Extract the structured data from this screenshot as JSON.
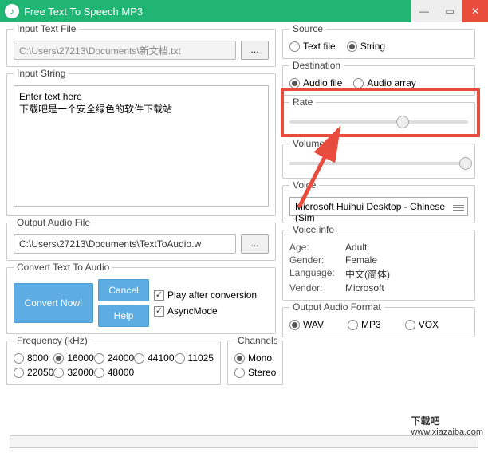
{
  "window": {
    "title": "Free Text To Speech MP3"
  },
  "left": {
    "input_file": {
      "legend": "Input Text File",
      "path": "C:\\Users\\27213\\Documents\\新文档.txt",
      "browse": "..."
    },
    "input_string": {
      "legend": "Input String",
      "placeholder": "Enter text here",
      "text": "下载吧是一个安全绿色的软件下载站"
    },
    "output_file": {
      "legend": "Output Audio File",
      "path": "C:\\Users\\27213\\Documents\\TextToAudio.w",
      "browse": "..."
    },
    "convert": {
      "legend": "Convert Text To Audio",
      "convert_now": "Convert Now!",
      "cancel": "Cancel",
      "help": "Help",
      "play_after": "Play after conversion",
      "async_mode": "AsyncMode"
    },
    "frequency": {
      "legend": "Frequency (kHz)",
      "options": [
        "8000",
        "16000",
        "24000",
        "44100",
        "11025",
        "22050",
        "32000",
        "48000"
      ],
      "selected": "16000"
    },
    "channels": {
      "legend": "Channels",
      "options": [
        "Mono",
        "Stereo"
      ],
      "selected": "Mono"
    }
  },
  "right": {
    "source": {
      "legend": "Source",
      "options": [
        "Text file",
        "String"
      ],
      "selected": "String"
    },
    "destination": {
      "legend": "Destination",
      "options": [
        "Audio file",
        "Audio array"
      ],
      "selected": "Audio file"
    },
    "rate": {
      "legend": "Rate",
      "value": 60
    },
    "volume": {
      "legend": "Volume",
      "value": 95
    },
    "voice": {
      "legend": "Voice",
      "selected": "Microsoft Huihui Desktop - Chinese (Sim"
    },
    "voice_info": {
      "legend": "Voice info",
      "rows": [
        [
          "Age:",
          "Adult"
        ],
        [
          "Gender:",
          "Female"
        ],
        [
          "Language:",
          "中文(简体)"
        ],
        [
          "Vendor:",
          "Microsoft"
        ]
      ]
    },
    "out_format": {
      "legend": "Output Audio Format",
      "options": [
        "WAV",
        "MP3",
        "VOX"
      ],
      "selected": "WAV"
    }
  },
  "watermark": {
    "text": "下载吧",
    "url": "www.xiazaiba.com"
  }
}
